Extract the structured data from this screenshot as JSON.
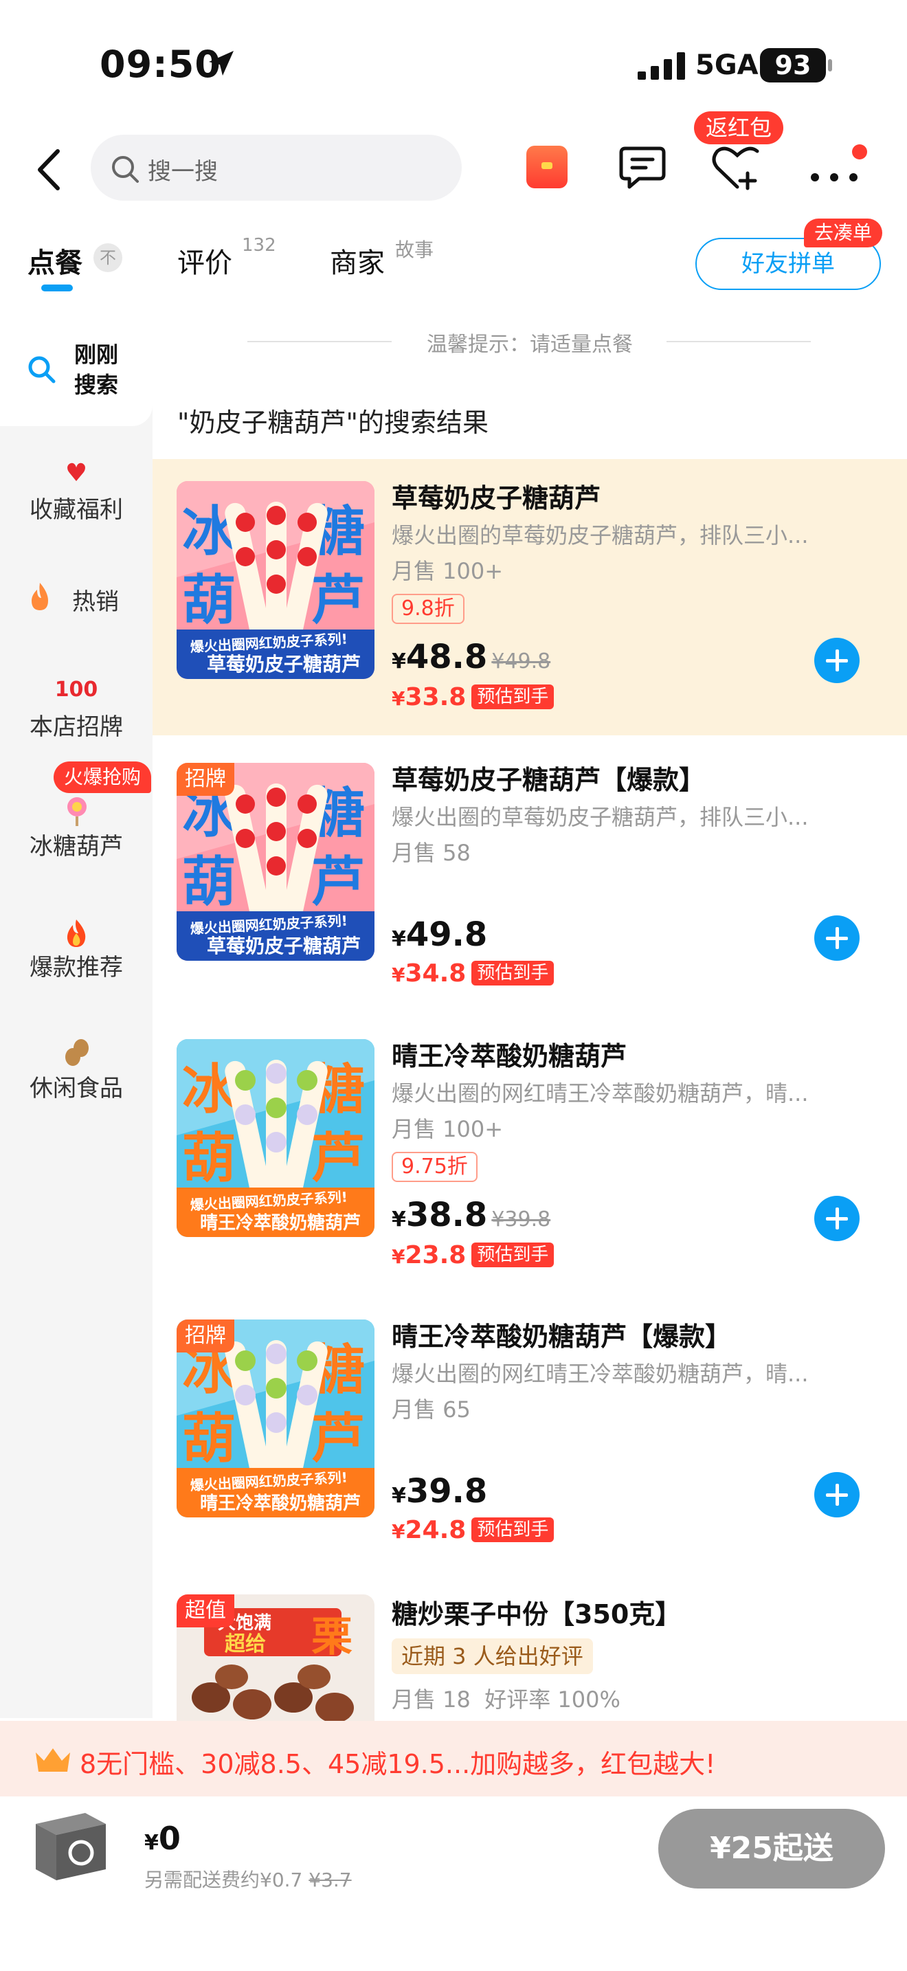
{
  "status_bar": {
    "time": "09:50",
    "network": "5GA",
    "battery": "93"
  },
  "nav": {
    "search_placeholder": "搜一搜",
    "red_packet_badge": "返红包"
  },
  "tabs": {
    "order": "点餐",
    "order_badge": "不",
    "review": "评价",
    "review_count": "132",
    "store": "商家",
    "store_sub": "故事",
    "friend_button": "好友拼单",
    "friend_badge": "去凑单"
  },
  "sidebar": {
    "items": [
      {
        "label": "刚刚\n搜索",
        "icon": "search-icon"
      },
      {
        "label": "收藏福利",
        "icon": "heart-icon"
      },
      {
        "label": "热销",
        "icon": "flame-icon"
      },
      {
        "label": "本店招牌",
        "icon": "hundred-icon"
      },
      {
        "label": "冰糖葫芦",
        "icon": "lollipop-icon",
        "badge": "火爆抢购"
      },
      {
        "label": "爆款推荐",
        "icon": "fire-icon"
      },
      {
        "label": "休闲食品",
        "icon": "peanut-icon"
      }
    ]
  },
  "content": {
    "tip": "温馨提示：请适量点餐",
    "results_title": "\"奶皮子糖葫芦\"的搜索结果",
    "estimate_label": "预估到手",
    "products": [
      {
        "title": "草莓奶皮子糖葫芦",
        "desc": "爆火出圈的草莓奶皮子糖葫芦，排队三小...",
        "sold": "月售 100+",
        "discount": "9.8折",
        "price": "48.8",
        "orig": "¥49.8",
        "final": "33.8"
      },
      {
        "title": "草莓奶皮子糖葫芦【爆款】",
        "desc": "爆火出圈的草莓奶皮子糖葫芦，排队三小...",
        "sold": "月售 58",
        "tag": "招牌",
        "price": "49.8",
        "final": "34.8"
      },
      {
        "title": "晴王冷萃酸奶糖葫芦",
        "desc": "爆火出圈的网红晴王冷萃酸奶糖葫芦，晴...",
        "sold": "月售 100+",
        "discount": "9.75折",
        "price": "38.8",
        "orig": "¥39.8",
        "final": "23.8"
      },
      {
        "title": "晴王冷萃酸奶糖葫芦【爆款】",
        "desc": "爆火出圈的网红晴王冷萃酸奶糖葫芦，晴...",
        "sold": "月售 65",
        "tag": "招牌",
        "price": "39.8",
        "final": "24.8"
      },
      {
        "title": "糖炒栗子中份【350克】",
        "review": "近期 3 人给出好评",
        "sold": "月售 18  好评率 100%",
        "tag": "超值"
      }
    ],
    "image_texts": {
      "series": "爆火出圈网红奶皮子系列!",
      "strawberry_name": "草莓奶皮子糖葫芦",
      "grape_name": "晴王冷萃酸奶糖葫芦",
      "big_chars": [
        "冰",
        "糖",
        "葫",
        "芦"
      ],
      "chestnut_banner": "大饱满",
      "chestnut_sub": "超给",
      "chestnut_big": "栗"
    }
  },
  "promo": {
    "text": "8无门槛、30减8.5、45减19.5...加购越多，红包越大!"
  },
  "cart": {
    "currency": "¥",
    "total": "0",
    "delivery_text": "另需配送费约¥0.7",
    "delivery_orig": "¥3.7",
    "min_order": "¥25起送"
  },
  "colors": {
    "accent": "#0a9ff5",
    "red": "#ff3b30",
    "highlight": "#fdf2dc"
  }
}
